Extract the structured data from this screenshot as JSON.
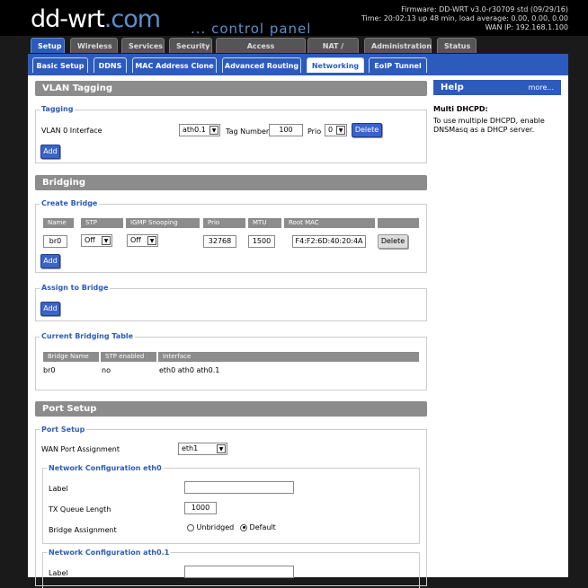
{
  "brand": {
    "logo_main": "dd-wrt",
    "logo_suffix": ".com",
    "tagline": "... control panel"
  },
  "status": {
    "firmware": "Firmware: DD-WRT v3.0-r30709 std (09/29/16)",
    "time": "Time: 20:02:13 up 48 min, load average: 0.00, 0.00, 0.00",
    "wan_ip": "WAN IP: 192.168.1.100"
  },
  "main_tabs": [
    "Setup",
    "Wireless",
    "Services",
    "Security",
    "Access Restrictions",
    "NAT / QoS",
    "Administration",
    "Status"
  ],
  "sub_tabs": [
    "Basic Setup",
    "DDNS",
    "MAC Address Clone",
    "Advanced Routing",
    "Networking",
    "EoIP Tunnel"
  ],
  "vlan": {
    "title": "VLAN Tagging",
    "legend": "Tagging",
    "iface_label": "VLAN 0 Interface",
    "iface_value": "ath0.1",
    "tag_label": "Tag Number",
    "tag_value": "100",
    "prio_label": "Prio",
    "prio_value": "0",
    "delete": "Delete",
    "add": "Add"
  },
  "bridging": {
    "title": "Bridging",
    "create_legend": "Create Bridge",
    "headers": [
      "Name",
      "STP",
      "IGMP Snooping",
      "Prio",
      "MTU",
      "Root MAC"
    ],
    "row": {
      "name": "br0",
      "stp": "Off",
      "igmp": "Off",
      "prio": "32768",
      "mtu": "1500",
      "mac": "F4:F2:6D:40:20:4A"
    },
    "delete": "Delete",
    "add": "Add",
    "assign_legend": "Assign to Bridge",
    "assign_add": "Add",
    "table_legend": "Current Bridging Table",
    "table_headers": [
      "Bridge Name",
      "STP enabled",
      "Interface"
    ],
    "table_row": {
      "name": "br0",
      "stp": "no",
      "iface": "eth0 ath0 ath0.1"
    }
  },
  "port": {
    "title": "Port Setup",
    "legend": "Port Setup",
    "wan_label": "WAN Port Assignment",
    "wan_value": "eth1",
    "net_eth0": "Network Configuration eth0",
    "label_label": "Label",
    "txq_label": "TX Queue Length",
    "txq_value": "1000",
    "bridge_label": "Bridge Assignment",
    "unbridged": "Unbridged",
    "default": "Default",
    "net_ath01": "Network Configuration ath0.1",
    "label_label2": "Label"
  },
  "help": {
    "title": "Help",
    "more": "more...",
    "heading": "Multi DHCPD:",
    "text": "To use multiple DHCPD, enable DNSMasq as a DHCP server."
  }
}
